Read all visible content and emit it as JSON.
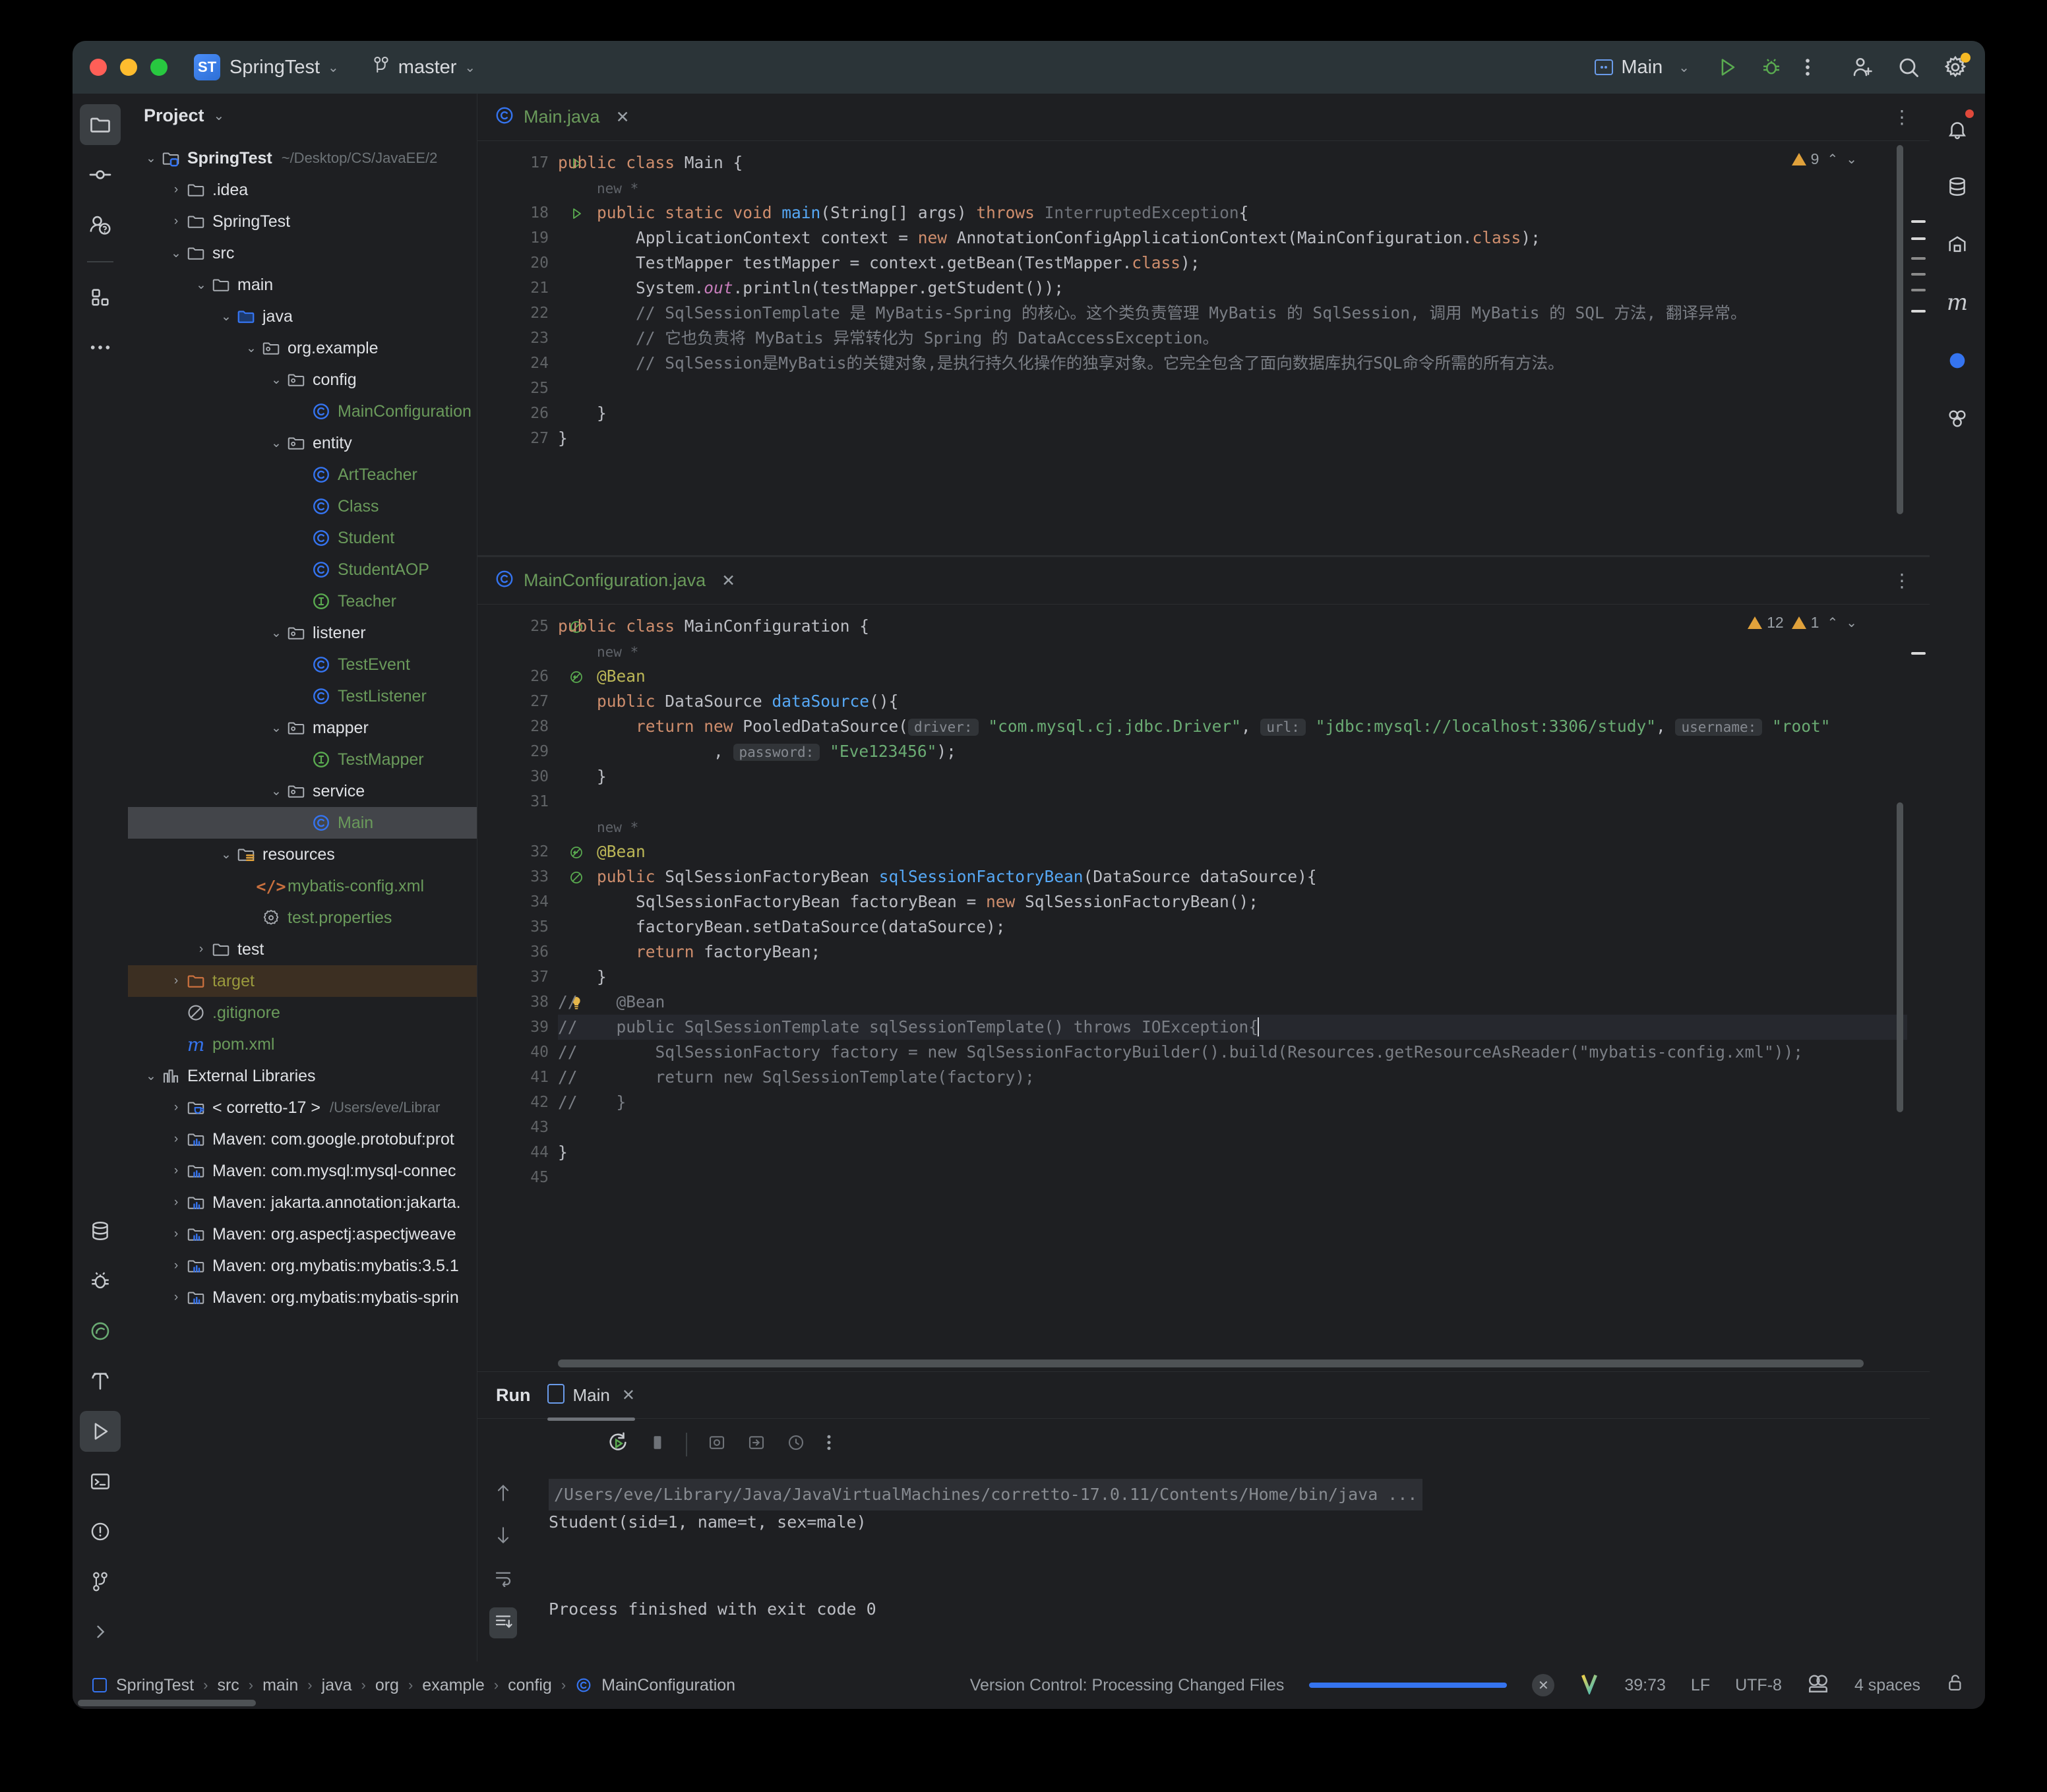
{
  "titlebar": {
    "project_badge": "ST",
    "project_name": "SpringTest",
    "branch": "master",
    "run_config": "Main"
  },
  "project_panel": {
    "header": "Project",
    "tree": [
      {
        "label": "SpringTest",
        "path": "~/Desktop/CS/JavaEE/2",
        "depth": 0,
        "arrow": "v",
        "icon": "module-folder",
        "style": "bold"
      },
      {
        "label": ".idea",
        "depth": 1,
        "arrow": ">",
        "icon": "folder",
        "style": "white"
      },
      {
        "label": "SpringTest",
        "depth": 1,
        "arrow": ">",
        "icon": "folder",
        "style": "white"
      },
      {
        "label": "src",
        "depth": 1,
        "arrow": "v",
        "icon": "folder",
        "style": "white"
      },
      {
        "label": "main",
        "depth": 2,
        "arrow": "v",
        "icon": "folder",
        "style": "white"
      },
      {
        "label": "java",
        "depth": 3,
        "arrow": "v",
        "icon": "source-folder",
        "style": "white"
      },
      {
        "label": "org.example",
        "depth": 4,
        "arrow": "v",
        "icon": "package",
        "style": "white"
      },
      {
        "label": "config",
        "depth": 5,
        "arrow": "v",
        "icon": "package",
        "style": "white"
      },
      {
        "label": "MainConfiguration",
        "depth": 6,
        "arrow": "",
        "icon": "class",
        "style": "green"
      },
      {
        "label": "entity",
        "depth": 5,
        "arrow": "v",
        "icon": "package",
        "style": "white"
      },
      {
        "label": "ArtTeacher",
        "depth": 6,
        "arrow": "",
        "icon": "class",
        "style": "green"
      },
      {
        "label": "Class",
        "depth": 6,
        "arrow": "",
        "icon": "class",
        "style": "green"
      },
      {
        "label": "Student",
        "depth": 6,
        "arrow": "",
        "icon": "class",
        "style": "green"
      },
      {
        "label": "StudentAOP",
        "depth": 6,
        "arrow": "",
        "icon": "class",
        "style": "green"
      },
      {
        "label": "Teacher",
        "depth": 6,
        "arrow": "",
        "icon": "interface",
        "style": "green"
      },
      {
        "label": "listener",
        "depth": 5,
        "arrow": "v",
        "icon": "package",
        "style": "white"
      },
      {
        "label": "TestEvent",
        "depth": 6,
        "arrow": "",
        "icon": "class",
        "style": "green"
      },
      {
        "label": "TestListener",
        "depth": 6,
        "arrow": "",
        "icon": "class",
        "style": "green"
      },
      {
        "label": "mapper",
        "depth": 5,
        "arrow": "v",
        "icon": "package",
        "style": "white"
      },
      {
        "label": "TestMapper",
        "depth": 6,
        "arrow": "",
        "icon": "interface",
        "style": "green"
      },
      {
        "label": "service",
        "depth": 5,
        "arrow": "v",
        "icon": "package",
        "style": "white"
      },
      {
        "label": "Main",
        "depth": 6,
        "arrow": "",
        "icon": "class",
        "style": "green",
        "selected": true
      },
      {
        "label": "resources",
        "depth": 3,
        "arrow": "v",
        "icon": "resources-folder",
        "style": "white"
      },
      {
        "label": "mybatis-config.xml",
        "depth": 4,
        "arrow": "",
        "icon": "xml",
        "style": "green"
      },
      {
        "label": "test.properties",
        "depth": 4,
        "arrow": "",
        "icon": "properties",
        "style": "green"
      },
      {
        "label": "test",
        "depth": 2,
        "arrow": ">",
        "icon": "folder",
        "style": "white"
      },
      {
        "label": "target",
        "depth": 1,
        "arrow": ">",
        "icon": "excluded-folder",
        "style": "olive",
        "highlight": true
      },
      {
        "label": ".gitignore",
        "depth": 1,
        "arrow": "",
        "icon": "gitignore",
        "style": "green"
      },
      {
        "label": "pom.xml",
        "depth": 1,
        "arrow": "",
        "icon": "maven",
        "style": "green"
      },
      {
        "label": "External Libraries",
        "depth": 0,
        "arrow": "v",
        "icon": "libraries",
        "style": "white"
      },
      {
        "label": "< corretto-17 >",
        "path": "/Users/eve/Librar",
        "depth": 1,
        "arrow": ">",
        "icon": "jdk",
        "style": "white"
      },
      {
        "label": "Maven: com.google.protobuf:prot",
        "depth": 1,
        "arrow": ">",
        "icon": "library",
        "style": "white"
      },
      {
        "label": "Maven: com.mysql:mysql-connec",
        "depth": 1,
        "arrow": ">",
        "icon": "library",
        "style": "white"
      },
      {
        "label": "Maven: jakarta.annotation:jakarta.",
        "depth": 1,
        "arrow": ">",
        "icon": "library",
        "style": "white"
      },
      {
        "label": "Maven: org.aspectj:aspectjweave",
        "depth": 1,
        "arrow": ">",
        "icon": "library",
        "style": "white"
      },
      {
        "label": "Maven: org.mybatis:mybatis:3.5.1",
        "depth": 1,
        "arrow": ">",
        "icon": "library",
        "style": "white"
      },
      {
        "label": "Maven: org.mybatis:mybatis-sprin",
        "depth": 1,
        "arrow": ">",
        "icon": "library",
        "style": "white"
      }
    ]
  },
  "editor_top": {
    "tab_name": "Main.java",
    "warn_count": "9",
    "fold_hint_above": "new *",
    "lines": [
      {
        "num": "17",
        "run_marker": true,
        "text": "public class Main {",
        "html": "<span class=\"kw\">public class</span> Main {"
      },
      {
        "num": "",
        "text": "    new *",
        "html": "    <span class=\"foldhint\">new *</span>"
      },
      {
        "num": "18",
        "run_marker": true,
        "text": "    public static void main(String[] args) throws InterruptedException{",
        "html": "    <span class=\"kw\">public static void</span> <span class=\"fn\">main</span>(String[] args) <span class=\"kw\">throws</span> <span class=\"dim\">InterruptedException</span>{"
      },
      {
        "num": "19",
        "text": "        ApplicationContext context = new AnnotationConfigApplicationContext(MainConfiguration.class);",
        "html": "        ApplicationContext context = <span class=\"kw\">new</span> AnnotationConfigApplicationContext(MainConfiguration.<span class=\"kw\">class</span>);"
      },
      {
        "num": "20",
        "text": "        TestMapper testMapper = context.getBean(TestMapper.class);",
        "html": "        TestMapper testMapper = context.getBean(TestMapper.<span class=\"kw\">class</span>);"
      },
      {
        "num": "21",
        "text": "        System.out.println(testMapper.getStudent());",
        "html": "        System.<span class=\"fld\"><i>out</i></span>.println(testMapper.getStudent());"
      },
      {
        "num": "22",
        "text": "        // SqlSessionTemplate 是 MyBatis-Spring 的核心。这个类负责管理 MyBatis 的 SqlSession, 调用 MyBatis 的 SQL 方法, 翻译异常。",
        "html": "        <span class=\"cmt\">// SqlSessionTemplate 是 MyBatis-Spring 的核心。这个类负责管理 MyBatis 的 SqlSession, 调用 MyBatis 的 SQL 方法, 翻译异常。</span>"
      },
      {
        "num": "23",
        "text": "        // 它也负责将 MyBatis 异常转化为 Spring 的 DataAccessException。",
        "html": "        <span class=\"cmt\">// 它也负责将 MyBatis 异常转化为 Spring 的 DataAccessException。</span>"
      },
      {
        "num": "24",
        "text": "        // SqlSession是MyBatis的关键对象,是执行持久化操作的独享对象。它完全包含了面向数据库执行SQL命令所需的所有方法。",
        "html": "        <span class=\"cmt\">// SqlSession是MyBatis的关键对象,是执行持久化操作的独享对象。它完全包含了面向数据库执行SQL命令所需的所有方法。</span>"
      },
      {
        "num": "25",
        "text": "",
        "html": ""
      },
      {
        "num": "26",
        "text": "    }",
        "html": "    }"
      },
      {
        "num": "27",
        "text": "}",
        "html": "}"
      }
    ]
  },
  "editor_bottom": {
    "tab_name": "MainConfiguration.java",
    "warn_count": "12",
    "error_count": "1",
    "lines": [
      {
        "num": "25",
        "gmark": "bean",
        "text": "public class MainConfiguration {",
        "html": "<span class=\"kw\">public class</span> MainConfiguration {"
      },
      {
        "num": "",
        "text": "    new *",
        "html": "    <span class=\"foldhint\">new *</span>"
      },
      {
        "num": "26",
        "gmark": "bean-arrow",
        "text": "    @Bean",
        "html": "    <span class=\"ann\">@Bean</span>"
      },
      {
        "num": "27",
        "text": "    public DataSource dataSource(){",
        "html": "    <span class=\"kw\">public</span> DataSource <span class=\"fn\">dataSource</span>(){"
      },
      {
        "num": "28",
        "text": "        return new PooledDataSource( driver: \"com.mysql.cj.jdbc.Driver\", url: \"jdbc:mysql://localhost:3306/study\", username: \"root\"",
        "html": "        <span class=\"kw\">return new</span> PooledDataSource(<span class=\"hintpill\">driver:</span> <span class=\"str\">\"com.mysql.cj.jdbc.Driver\"</span>, <span class=\"hintpill\">url:</span> <span class=\"str\">\"jdbc:mysql://localhost:3306/study\"</span>, <span class=\"hintpill\">username:</span> <span class=\"str\">\"root\"</span>"
      },
      {
        "num": "29",
        "text": "                , password: \"Eve123456\");",
        "html": "                , <span class=\"hintpill\">password:</span> <span class=\"str\">\"Eve123456\"</span>);"
      },
      {
        "num": "30",
        "text": "    }",
        "html": "    }"
      },
      {
        "num": "31",
        "text": "",
        "html": ""
      },
      {
        "num": "",
        "text": "    new *",
        "html": "    <span class=\"foldhint\">new *</span>"
      },
      {
        "num": "32",
        "gmark": "bean-arrow",
        "text": "    @Bean",
        "html": "    <span class=\"ann\">@Bean</span>"
      },
      {
        "num": "33",
        "gmark": "bean",
        "text": "    public SqlSessionFactoryBean sqlSessionFactoryBean(DataSource dataSource){",
        "html": "    <span class=\"kw\">public</span> SqlSessionFactoryBean <span class=\"fn\">sqlSessionFactoryBean</span>(DataSource dataSource){"
      },
      {
        "num": "34",
        "text": "        SqlSessionFactoryBean factoryBean = new SqlSessionFactoryBean();",
        "html": "        SqlSessionFactoryBean factoryBean = <span class=\"kw\">new</span> SqlSessionFactoryBean();"
      },
      {
        "num": "35",
        "text": "        factoryBean.setDataSource(dataSource);",
        "html": "        factoryBean.setDataSource(dataSource);"
      },
      {
        "num": "36",
        "text": "        return factoryBean;",
        "html": "        <span class=\"kw\">return</span> factoryBean;"
      },
      {
        "num": "37",
        "text": "    }",
        "html": "    }"
      },
      {
        "num": "38",
        "gmark": "bulb",
        "text": "//    @Bean",
        "html": "<span class=\"cmt\">//</span>    <span class=\"cmt\">@Bean</span>"
      },
      {
        "num": "39",
        "caret": true,
        "hl": true,
        "text": "//    public SqlSessionTemplate sqlSessionTemplate() throws IOException{",
        "html": "<span class=\"cmt\">//    public SqlSessionTemplate sqlSessionTemplate() throws IOException{</span>"
      },
      {
        "num": "40",
        "text": "//        SqlSessionFactory factory = new SqlSessionFactoryBuilder().build(Resources.getResourceAsReader(\"mybatis-config.xml\"));",
        "html": "<span class=\"cmt\">//        SqlSessionFactory factory = new SqlSessionFactoryBuilder().build(Resources.getResourceAsReader(\"mybatis-config.xml\"));</span>"
      },
      {
        "num": "41",
        "text": "//        return new SqlSessionTemplate(factory);",
        "html": "<span class=\"cmt\">//        return new SqlSessionTemplate(factory);</span>"
      },
      {
        "num": "42",
        "text": "//    }",
        "html": "<span class=\"cmt\">//    }</span>"
      },
      {
        "num": "43",
        "text": "",
        "html": ""
      },
      {
        "num": "44",
        "text": "}",
        "html": "}"
      },
      {
        "num": "45",
        "text": "",
        "html": ""
      }
    ]
  },
  "run_panel": {
    "title": "Run",
    "tab_label": "Main",
    "output": [
      {
        "text": "/Users/eve/Library/Java/JavaVirtualMachines/corretto-17.0.11/Contents/Home/bin/java ...",
        "style": "cmd"
      },
      {
        "text": "Student(sid=1, name=t, sex=male)",
        "style": "normal"
      },
      {
        "text": "",
        "style": "normal"
      },
      {
        "text": "",
        "style": "normal"
      },
      {
        "text": "Process finished with exit code 0",
        "style": "normal"
      }
    ]
  },
  "status_bar": {
    "breadcrumb": [
      "SpringTest",
      "src",
      "main",
      "java",
      "org",
      "example",
      "config",
      "MainConfiguration"
    ],
    "vcs_message": "Version Control: Processing Changed Files",
    "caret_position": "39:73",
    "line_separator": "LF",
    "encoding": "UTF-8",
    "indent": "4 spaces"
  },
  "colors": {
    "accent_blue": "#3574f0",
    "green_text": "#6a9a5b",
    "warn_yellow": "#e0a13b",
    "titlebar_bg": "#2b3438",
    "editor_bg": "#1e1f22"
  }
}
